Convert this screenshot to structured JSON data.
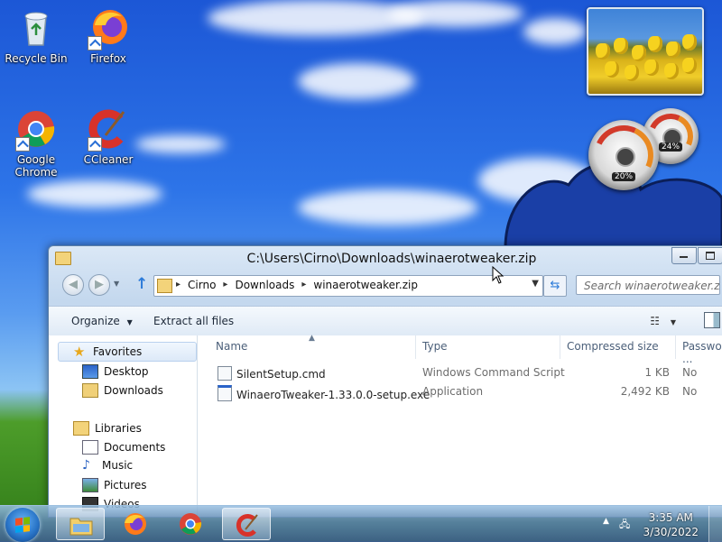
{
  "desktop": {
    "icons": [
      {
        "label": "Recycle Bin"
      },
      {
        "label": "Firefox"
      },
      {
        "label": "Google Chrome"
      },
      {
        "label": "CCleaner"
      }
    ],
    "gadgets": {
      "cpu_percent": "20%",
      "memory_percent": "24%"
    }
  },
  "window": {
    "title": "C:\\Users\\Cirno\\Downloads\\winaerotweaker.zip",
    "breadcrumb": [
      "Cirno",
      "Downloads",
      "winaerotweaker.zip"
    ],
    "search_placeholder": "Search winaerotweaker.zip",
    "toolbar": {
      "organize": "Organize",
      "extract_all": "Extract all files"
    },
    "nav_pane": {
      "favorites": "Favorites",
      "desktop": "Desktop",
      "downloads": "Downloads",
      "libraries": "Libraries",
      "documents": "Documents",
      "music": "Music",
      "pictures": "Pictures",
      "videos": "Videos"
    },
    "columns": {
      "name": "Name",
      "type": "Type",
      "compressed_size": "Compressed size",
      "password": "Password ..."
    },
    "files": [
      {
        "name": "SilentSetup.cmd",
        "type": "Windows Command Script",
        "size": "1 KB",
        "password": "No"
      },
      {
        "name": "WinaeroTweaker-1.33.0.0-setup.exe",
        "type": "Application",
        "size": "2,492 KB",
        "password": "No"
      }
    ]
  },
  "taskbar": {
    "apps": [
      "Windows Explorer",
      "Firefox",
      "Google Chrome",
      "CCleaner"
    ],
    "clock_time": "3:35 AM",
    "clock_date": "3/30/2022"
  },
  "colors": {
    "desktop_sky": "#2d74e8",
    "window_frame": "#c4d8ee",
    "taskbar": "#5a82aa"
  }
}
